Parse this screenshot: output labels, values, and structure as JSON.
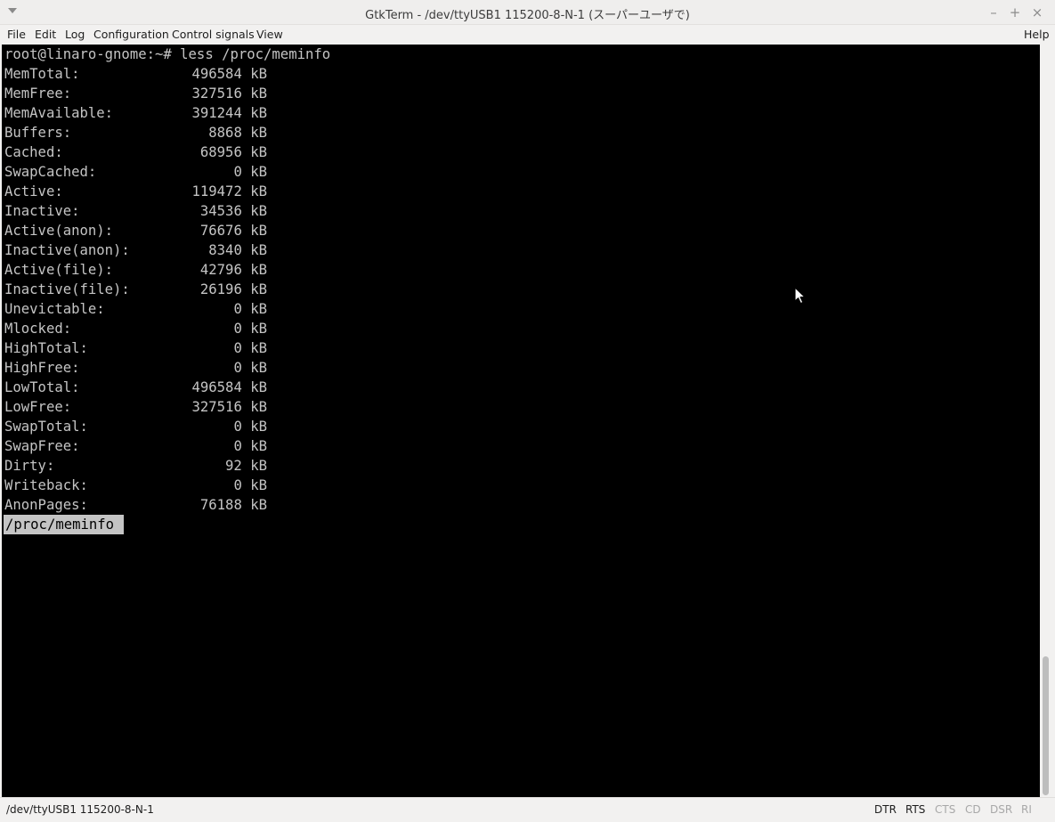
{
  "window": {
    "title": "GtkTerm - /dev/ttyUSB1  115200-8-N-1 (スーパーユーザで)",
    "minimize": "–",
    "maximize": "+",
    "close": "×"
  },
  "menubar": {
    "items": [
      "File",
      "Edit",
      "Log",
      "Configuration",
      "Control signals",
      "View"
    ],
    "help": "Help"
  },
  "terminal": {
    "command_line": "root@linaro-gnome:~# less /proc/meminfo",
    "meminfo": [
      {
        "key": "MemTotal:",
        "value": "496584 kB"
      },
      {
        "key": "MemFree:",
        "value": "327516 kB"
      },
      {
        "key": "MemAvailable:",
        "value": "391244 kB"
      },
      {
        "key": "Buffers:",
        "value": "8868 kB"
      },
      {
        "key": "Cached:",
        "value": "68956 kB"
      },
      {
        "key": "SwapCached:",
        "value": "0 kB"
      },
      {
        "key": "Active:",
        "value": "119472 kB"
      },
      {
        "key": "Inactive:",
        "value": "34536 kB"
      },
      {
        "key": "Active(anon):",
        "value": "76676 kB"
      },
      {
        "key": "Inactive(anon):",
        "value": "8340 kB"
      },
      {
        "key": "Active(file):",
        "value": "42796 kB"
      },
      {
        "key": "Inactive(file):",
        "value": "26196 kB"
      },
      {
        "key": "Unevictable:",
        "value": "0 kB"
      },
      {
        "key": "Mlocked:",
        "value": "0 kB"
      },
      {
        "key": "HighTotal:",
        "value": "0 kB"
      },
      {
        "key": "HighFree:",
        "value": "0 kB"
      },
      {
        "key": "LowTotal:",
        "value": "496584 kB"
      },
      {
        "key": "LowFree:",
        "value": "327516 kB"
      },
      {
        "key": "SwapTotal:",
        "value": "0 kB"
      },
      {
        "key": "SwapFree:",
        "value": "0 kB"
      },
      {
        "key": "Dirty:",
        "value": "92 kB"
      },
      {
        "key": "Writeback:",
        "value": "0 kB"
      },
      {
        "key": "AnonPages:",
        "value": "76188 kB"
      }
    ],
    "less_prompt": "/proc/meminfo"
  },
  "statusbar": {
    "port_info": "/dev/ttyUSB1  115200-8-N-1",
    "signals": [
      {
        "label": "DTR",
        "active": true
      },
      {
        "label": "RTS",
        "active": true
      },
      {
        "label": "CTS",
        "active": false
      },
      {
        "label": "CD",
        "active": false
      },
      {
        "label": "DSR",
        "active": false
      },
      {
        "label": "RI",
        "active": false
      }
    ]
  },
  "colors": {
    "terminal_bg": "#000000",
    "terminal_fg": "#c4c4c4",
    "chrome_bg": "#f2f1f0",
    "signal_inactive": "#a8a8a8"
  },
  "icons": {
    "window_menu": "triangle-down-icon",
    "pointer": "mouse-pointer-icon"
  }
}
